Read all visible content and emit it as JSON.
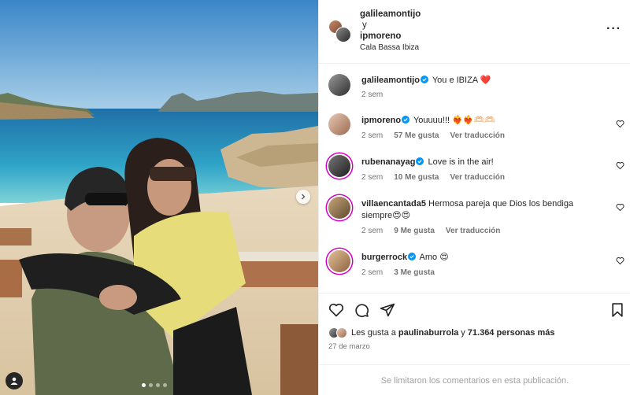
{
  "post": {
    "carousel_dots": 4,
    "active_dot": 0
  },
  "header": {
    "user1": "galileamontijo",
    "conjunction": "y",
    "user2": "ipmoreno",
    "location": "Cala Bassa Ibiza"
  },
  "comments": [
    {
      "user": "galileamontijo",
      "text": "You e IBIZA ❤️",
      "time": "2 sem",
      "likes": "",
      "translate": ""
    },
    {
      "user": "ipmoreno",
      "text": "Youuuu!!! ❤️‍🔥❤️‍🔥🫶🏻🫶🏻",
      "time": "2 sem",
      "likes": "57 Me gusta",
      "translate": "Ver traducción"
    },
    {
      "user": "rubenanayag",
      "text": "Love is in the air!",
      "time": "2 sem",
      "likes": "10 Me gusta",
      "translate": "Ver traducción"
    },
    {
      "user": "villaencantada5",
      "text": "Hermosa pareja que Dios los bendiga siempre😍😍",
      "time": "2 sem",
      "likes": "9 Me gusta",
      "translate": "Ver traducción"
    },
    {
      "user": "burgerrock",
      "text": "Amo 😍",
      "time": "2 sem",
      "likes": "3 Me gusta",
      "translate": ""
    }
  ],
  "likes_summary": {
    "prefix": "Les gusta a",
    "user": "paulinaburrola",
    "middle": "y",
    "others": "71.364 personas más"
  },
  "date": "27 de marzo",
  "comments_limited": "Se limitaron los comentarios en esta publicación.",
  "icons": {
    "more": "more-horizontal-icon",
    "like": "heart-icon",
    "comment": "comment-icon",
    "share": "send-icon",
    "save": "bookmark-icon",
    "verified": "verified-badge-icon",
    "next": "chevron-right-icon",
    "tags": "person-tag-icon"
  },
  "colors": {
    "verified": "#0095f6",
    "heart_red": "#ed4956",
    "muted": "#737373",
    "story_ring": "#d300c5"
  }
}
